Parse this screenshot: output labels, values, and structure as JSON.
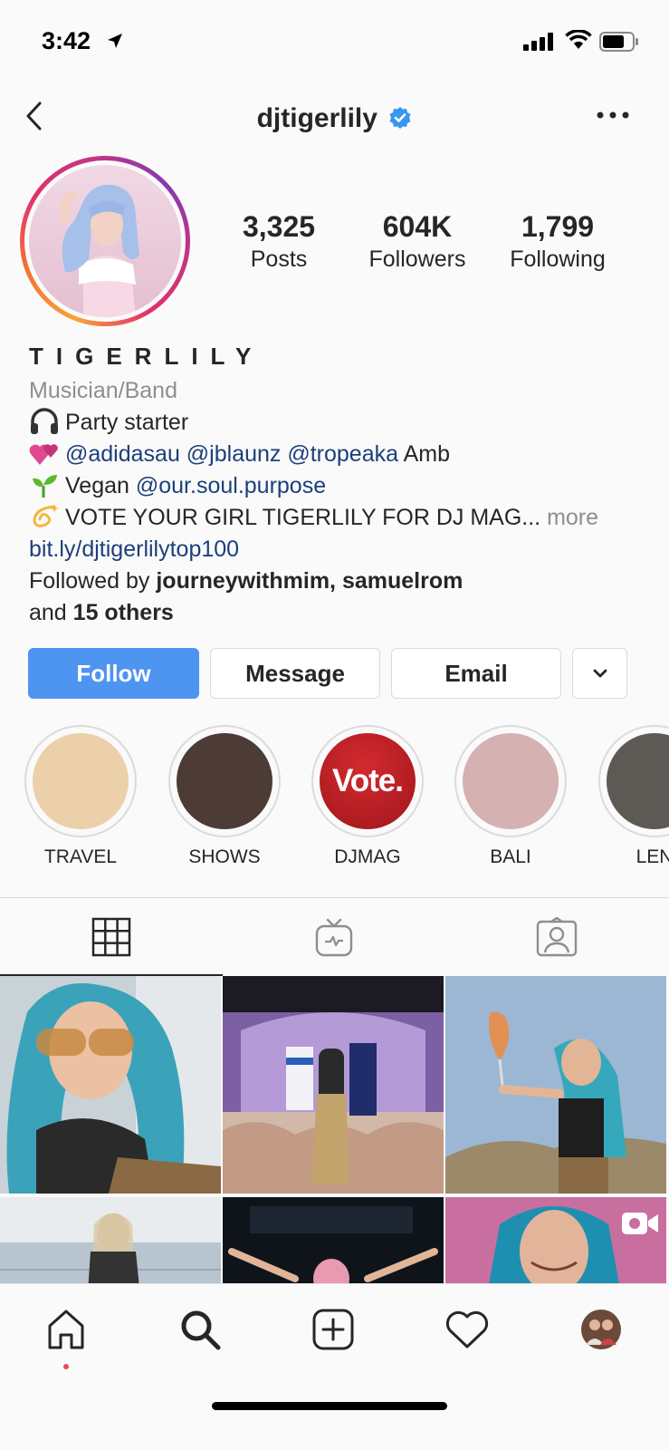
{
  "status_bar": {
    "time": "3:42"
  },
  "header": {
    "username": "djtigerlily"
  },
  "stats": [
    {
      "value": "3,325",
      "label": "Posts"
    },
    {
      "value": "604K",
      "label": "Followers"
    },
    {
      "value": "1,799",
      "label": "Following"
    }
  ],
  "bio": {
    "name": "TIGERLILY",
    "category": "Musician/Band",
    "line1": "Party starter",
    "line2_mentions": "@adidasau @jblaunz @tropeaka",
    "line2_tail": "Amb",
    "line3_text": "Vegan",
    "line3_mention": "@our.soul.purpose",
    "line4_text": "VOTE YOUR GIRL TIGERLILY FOR DJ MAG...",
    "line4_more": "more",
    "link": "bit.ly/djtigerlilytop100",
    "followed_prefix": "Followed by",
    "followed_names": "journeywithmim, samuelrom",
    "followed_and": "and",
    "followed_others": "15 others"
  },
  "buttons": {
    "follow": "Follow",
    "message": "Message",
    "email": "Email"
  },
  "highlights": [
    {
      "label": "TRAVEL",
      "color": "#ecd0a9"
    },
    {
      "label": "SHOWS",
      "color": "#4d3c35"
    },
    {
      "label": "DJMAG",
      "color": "#b3191f",
      "badge": "Vote."
    },
    {
      "label": "BALI",
      "color": "#d6b1b1"
    },
    {
      "label": "LEN",
      "color": "#5d5a56"
    }
  ],
  "colors": {
    "accent": "#4e94f1",
    "link": "#1c3f7a",
    "muted": "#8e8e8e",
    "notification": "#ed4956"
  },
  "icons": [
    "back-icon",
    "verified-icon",
    "more-icon",
    "grid-icon",
    "igtv-icon",
    "tagged-icon",
    "home-icon",
    "search-icon",
    "add-icon",
    "heart-icon",
    "profile-avatar-icon",
    "video-icon"
  ]
}
